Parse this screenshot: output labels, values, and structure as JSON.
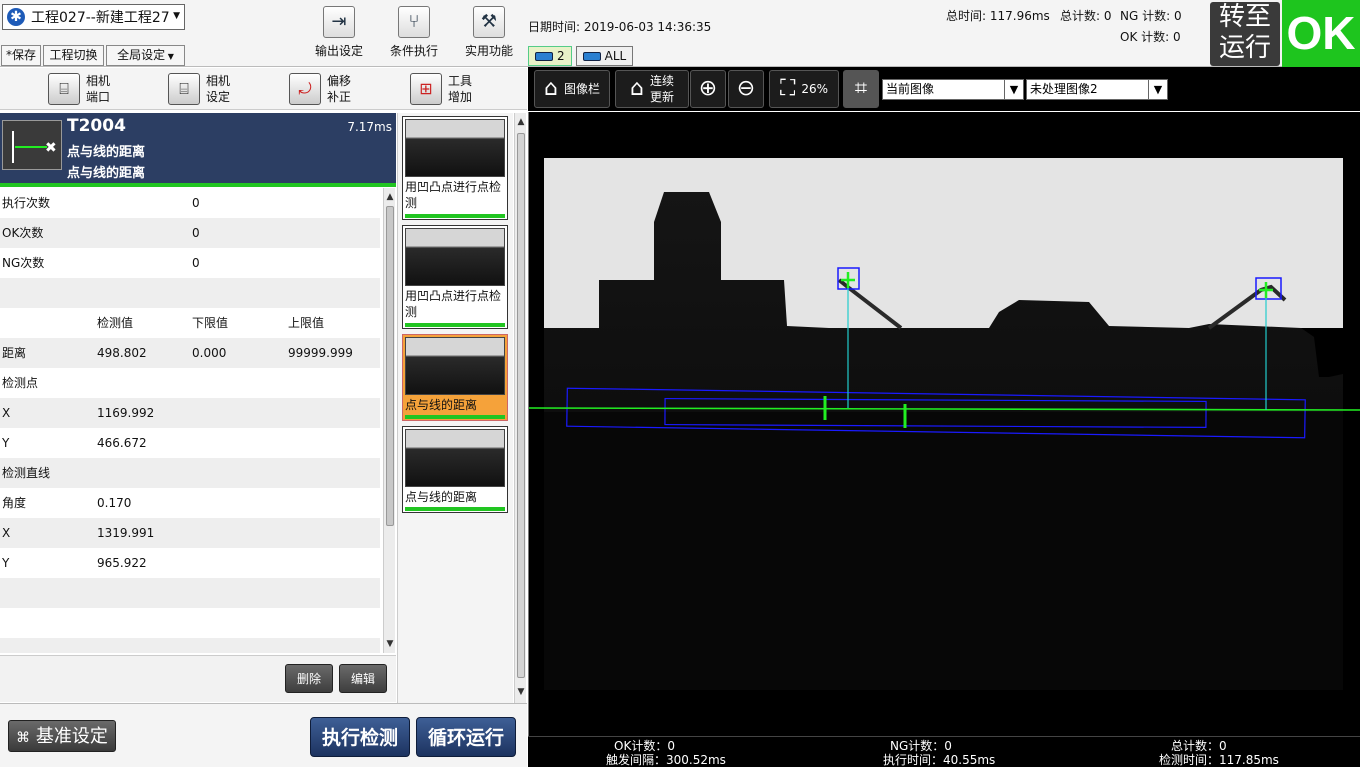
{
  "project": {
    "title": "工程027--新建工程27"
  },
  "top_buttons": {
    "save": "*保存",
    "switch_project": "工程切换",
    "global_settings": "全局设定"
  },
  "toolbar": {
    "output": "输出设定",
    "condition": "条件执行",
    "utility": "实用功能"
  },
  "datetime": "日期时间: 2019-06-03 14:36:35",
  "stats": {
    "total_time": "总时间:  117.96ms",
    "total_count": "总计数: 0",
    "ng_count": "NG 计数: 0",
    "ok_count": "OK 计数: 0"
  },
  "channel_tabs": [
    {
      "label": "2"
    },
    {
      "label": "ALL"
    }
  ],
  "switch_run": {
    "line1": "转至",
    "line2": "运行"
  },
  "ok_status": "OK",
  "left_tools": {
    "cam_port": {
      "l1": "相机",
      "l2": "端口"
    },
    "cam_set": {
      "l1": "相机",
      "l2": "设定"
    },
    "offset": {
      "l1": "偏移",
      "l2": "补正"
    },
    "tool_add": {
      "l1": "工具",
      "l2": "增加"
    }
  },
  "tool": {
    "id": "T2004",
    "time": "7.17ms",
    "name1": "点与线的距离",
    "name2": "点与线的距离"
  },
  "table": {
    "exec_count_label": "执行次数",
    "exec_count": "0",
    "ok_count_label": "OK次数",
    "ok_count": "0",
    "ng_count_label": "NG次数",
    "ng_count": "0",
    "col_measured": "检测值",
    "col_lower": "下限值",
    "col_upper": "上限值",
    "distance_label": "距离",
    "distance_value": "498.802",
    "distance_lower": "0.000",
    "distance_upper": "99999.999",
    "point_section": "检测点",
    "point_x_label": "X",
    "point_x": "1169.992",
    "point_y_label": "Y",
    "point_y": "466.672",
    "line_section": "检测直线",
    "angle_label": "角度",
    "angle": "0.170",
    "line_x_label": "X",
    "line_x": "1319.991",
    "line_y_label": "Y",
    "line_y": "965.922"
  },
  "action_buttons": {
    "delete": "删除",
    "edit": "编辑"
  },
  "thumbnails": [
    {
      "label": "用凹凸点进行点检测"
    },
    {
      "label": "用凹凸点进行点检测"
    },
    {
      "label": "点与线的距离"
    },
    {
      "label": "点与线的距离"
    }
  ],
  "bottom": {
    "base_settings": "基准设定",
    "execute": "执行检测",
    "loop_run": "循环运行"
  },
  "image_toolbar": {
    "image_bar": "图像栏",
    "continuous_l1": "连续",
    "continuous_l2": "更新",
    "zoom": "26%",
    "image_select": "当前图像",
    "raw_select": "未处理图像2"
  },
  "status": {
    "ok_count": "OK计数：0",
    "trigger_interval": "触发间隔：300.52ms",
    "ng_count": "NG计数：0",
    "exec_time": "执行时间：40.55ms",
    "total_count": "总计数：0",
    "detect_time": "检测时间：117.85ms"
  },
  "colors": {
    "ok_green": "#1ec51e",
    "header_navy": "#2c3e63",
    "accent_orange": "#f5a23a",
    "overlay_green": "#22ee22",
    "overlay_blue": "#1a1aff"
  }
}
